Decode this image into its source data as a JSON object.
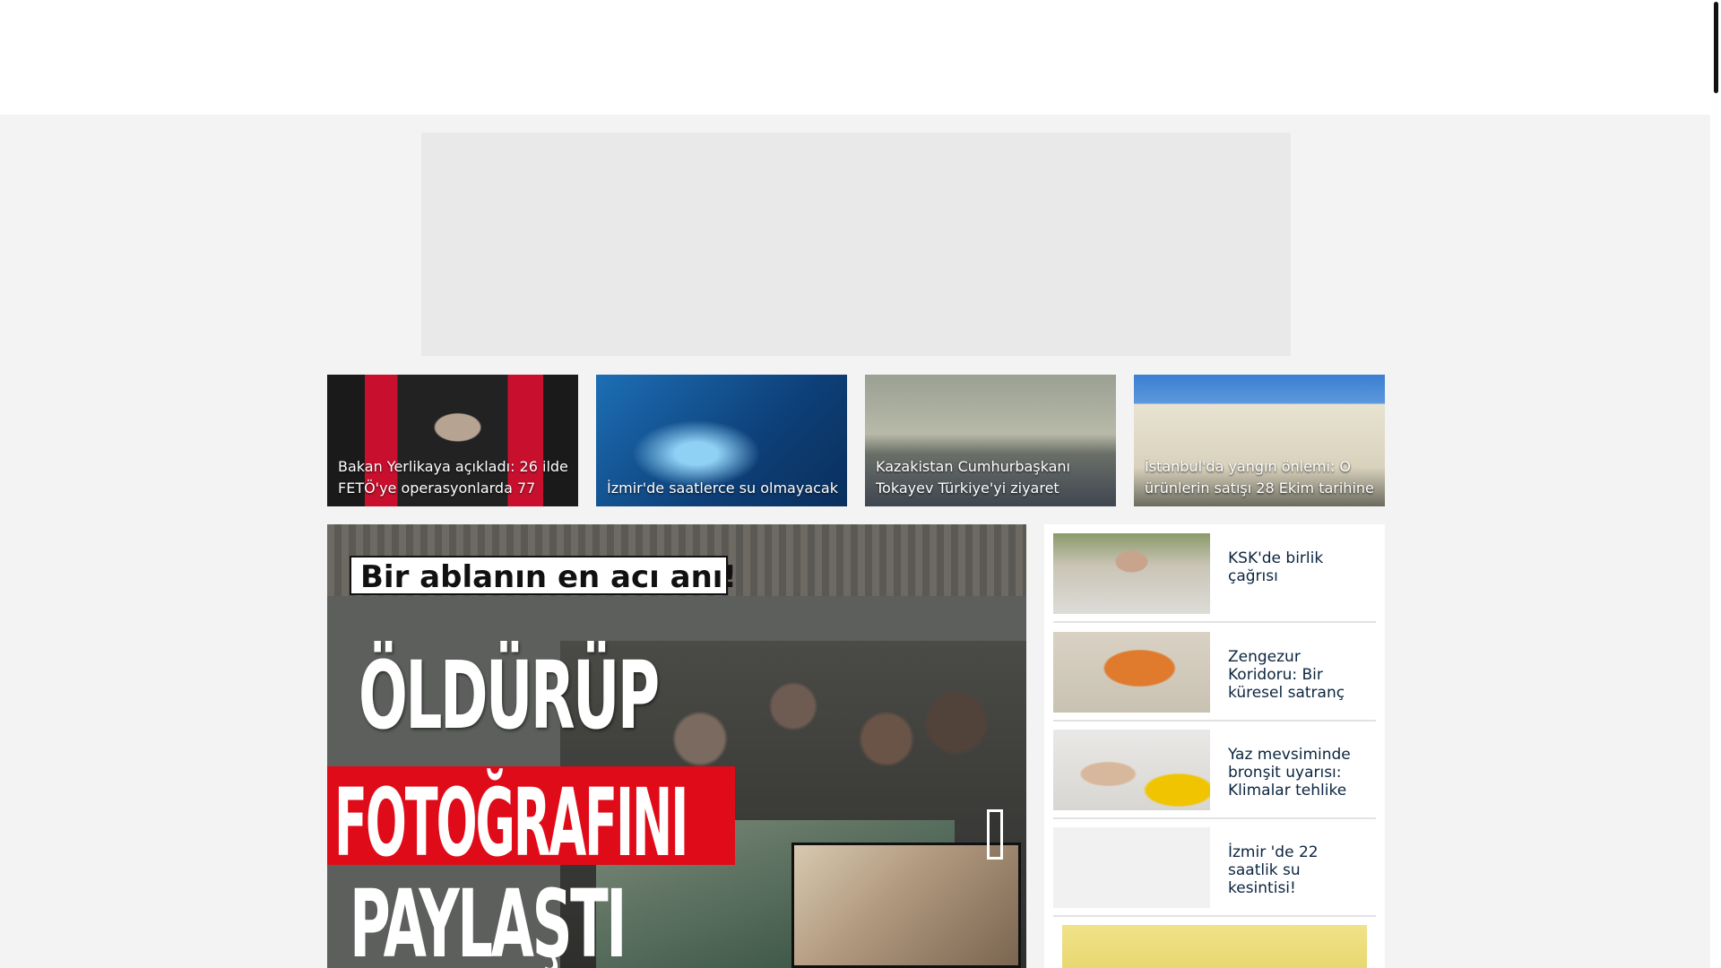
{
  "top_cards": [
    {
      "caption": "Bakan Yerlikaya açıkladı: 26 ilde FETÖ'ye operasyonlarda 77",
      "image": "official-portrait-with-flags"
    },
    {
      "caption": "İzmir'de saatlerce su olmayacak",
      "image": "water-faucet-glass"
    },
    {
      "caption": "Kazakistan Cumhurbaşkanı Tokayev Türkiye'yi ziyaret",
      "image": "state-ceremony"
    },
    {
      "caption": "İstanbul'da yangın önlemi: O ürünlerin satışı 28 Ekim tarihine",
      "image": "government-building"
    }
  ],
  "hero": {
    "label": "Bir ablanın en acı anı!",
    "headline_lines": [
      "ÖLDÜRÜP",
      "FOTOĞRAFINI",
      "PAYLAŞTI"
    ],
    "next_icon": "chevron-right-icon"
  },
  "side_list": [
    {
      "title": "KSK'de birlik çağrısı",
      "image": "press-statement-photo"
    },
    {
      "title": "Zengezur Koridoru: Bir küresel satranç",
      "image": "regional-map"
    },
    {
      "title": "Yaz mevsiminde bronşit uyarısı: Klimalar tehlike",
      "image": "sick-person-air-conditioner"
    },
    {
      "title": "İzmir 'de 22 saatlik su kesintisi!",
      "image": "placeholder"
    }
  ],
  "colors": {
    "brand_red": "#e00b18",
    "title_navy": "#0b2540",
    "page_background": "#f3f3f3",
    "ad_placeholder": "#e9e9e9"
  }
}
